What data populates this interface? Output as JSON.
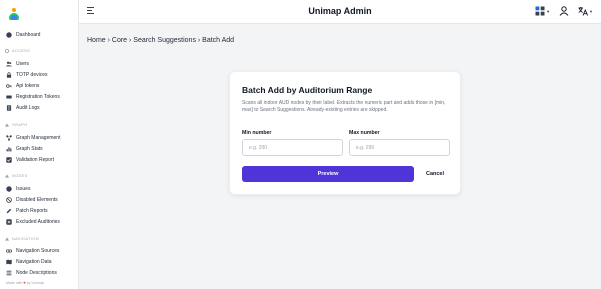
{
  "app": {
    "title": "Unimap Admin"
  },
  "breadcrumb": "Home › Core › Search Suggestions › Batch Add",
  "sidebar": {
    "dashboard": {
      "label": "Dashboard",
      "icon": "dashboard-icon"
    },
    "sections": {
      "access": "ACCESS",
      "graph": "GRAPH",
      "nodes": "NODES",
      "navigation": "NAVIGATION"
    },
    "access_items": [
      {
        "label": "Users",
        "icon": "users-icon"
      },
      {
        "label": "TOTP devices",
        "icon": "lock-icon"
      },
      {
        "label": "Api tokens",
        "icon": "key-icon"
      },
      {
        "label": "Registration Tokens",
        "icon": "ticket-icon"
      },
      {
        "label": "Audit Logs",
        "icon": "document-icon"
      }
    ],
    "graph_items": [
      {
        "label": "Graph Management",
        "icon": "graph-icon"
      },
      {
        "label": "Graph Stats",
        "icon": "chart-icon"
      },
      {
        "label": "Validation Report",
        "icon": "check-icon"
      }
    ],
    "nodes_items": [
      {
        "label": "Issues",
        "icon": "alert-icon"
      },
      {
        "label": "Disabled Elements",
        "icon": "ban-icon"
      },
      {
        "label": "Patch Reports",
        "icon": "edit-icon"
      },
      {
        "label": "Excluded Auditories",
        "icon": "exclude-icon"
      }
    ],
    "navigation_items": [
      {
        "label": "Navigation Sources",
        "icon": "link-icon"
      },
      {
        "label": "Navigation Data",
        "icon": "map-icon"
      },
      {
        "label": "Node Descriptions",
        "icon": "list-icon"
      }
    ],
    "footer": {
      "prefix": "Made with",
      "suffix": "by Unimap"
    }
  },
  "card": {
    "title": "Batch Add by Auditorium Range",
    "description": "Scans all indoor AUD nodes by their label. Extracts the numeric part and adds those in [min, max] to Search Suggestions. Already-existing entries are skipped.",
    "min": {
      "label": "Min number",
      "placeholder": "e.g. 200",
      "value": ""
    },
    "max": {
      "label": "Max number",
      "placeholder": "e.g. 299",
      "value": ""
    },
    "preview_label": "Preview",
    "cancel_label": "Cancel"
  },
  "colors": {
    "primary": "#4f35d8",
    "background": "#f3f4f6"
  }
}
